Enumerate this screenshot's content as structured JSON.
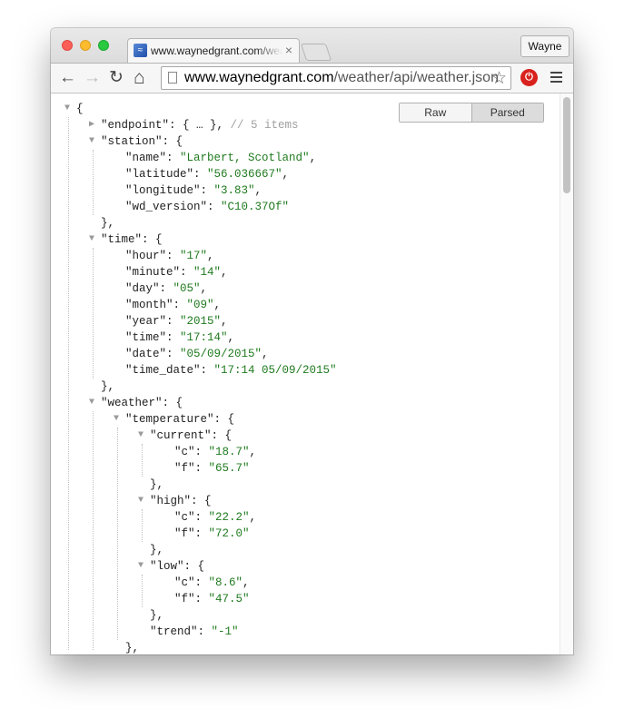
{
  "tab": {
    "title": "www.waynedgrant.com/weather/api/weather.json",
    "close": "×"
  },
  "profile": {
    "name": "Wayne"
  },
  "omnibox": {
    "host": "www.waynedgrant.com",
    "path": "/weather/api/weather.json"
  },
  "icons": {
    "back": "←",
    "forward": "→",
    "reload": "↻",
    "home": "⌂",
    "star": "☆",
    "ext": "⏻"
  },
  "view_toggle": {
    "raw": "Raw",
    "parsed": "Parsed"
  },
  "json_lines": [
    {
      "depth": 0,
      "arrow": "▼",
      "t": [
        [
          "p",
          "{"
        ]
      ]
    },
    {
      "depth": 1,
      "arrow": "▶",
      "t": [
        [
          "k",
          "\"endpoint\""
        ],
        [
          "p",
          ": { … }, "
        ],
        [
          "c",
          "// 5 items"
        ]
      ]
    },
    {
      "depth": 1,
      "arrow": "▼",
      "t": [
        [
          "k",
          "\"station\""
        ],
        [
          "p",
          ": {"
        ]
      ]
    },
    {
      "depth": 2,
      "t": [
        [
          "k",
          "\"name\""
        ],
        [
          "p",
          ": "
        ],
        [
          "s",
          "\"Larbert, Scotland\""
        ],
        [
          "p",
          ","
        ]
      ]
    },
    {
      "depth": 2,
      "t": [
        [
          "k",
          "\"latitude\""
        ],
        [
          "p",
          ": "
        ],
        [
          "s",
          "\"56.036667\""
        ],
        [
          "p",
          ","
        ]
      ]
    },
    {
      "depth": 2,
      "t": [
        [
          "k",
          "\"longitude\""
        ],
        [
          "p",
          ": "
        ],
        [
          "s",
          "\"3.83\""
        ],
        [
          "p",
          ","
        ]
      ]
    },
    {
      "depth": 2,
      "t": [
        [
          "k",
          "\"wd_version\""
        ],
        [
          "p",
          ": "
        ],
        [
          "s",
          "\"C10.37Of\""
        ]
      ]
    },
    {
      "depth": 1,
      "t": [
        [
          "p",
          "},"
        ]
      ]
    },
    {
      "depth": 1,
      "arrow": "▼",
      "t": [
        [
          "k",
          "\"time\""
        ],
        [
          "p",
          ": {"
        ]
      ]
    },
    {
      "depth": 2,
      "t": [
        [
          "k",
          "\"hour\""
        ],
        [
          "p",
          ": "
        ],
        [
          "s",
          "\"17\""
        ],
        [
          "p",
          ","
        ]
      ]
    },
    {
      "depth": 2,
      "t": [
        [
          "k",
          "\"minute\""
        ],
        [
          "p",
          ": "
        ],
        [
          "s",
          "\"14\""
        ],
        [
          "p",
          ","
        ]
      ]
    },
    {
      "depth": 2,
      "t": [
        [
          "k",
          "\"day\""
        ],
        [
          "p",
          ": "
        ],
        [
          "s",
          "\"05\""
        ],
        [
          "p",
          ","
        ]
      ]
    },
    {
      "depth": 2,
      "t": [
        [
          "k",
          "\"month\""
        ],
        [
          "p",
          ": "
        ],
        [
          "s",
          "\"09\""
        ],
        [
          "p",
          ","
        ]
      ]
    },
    {
      "depth": 2,
      "t": [
        [
          "k",
          "\"year\""
        ],
        [
          "p",
          ": "
        ],
        [
          "s",
          "\"2015\""
        ],
        [
          "p",
          ","
        ]
      ]
    },
    {
      "depth": 2,
      "t": [
        [
          "k",
          "\"time\""
        ],
        [
          "p",
          ": "
        ],
        [
          "s",
          "\"17:14\""
        ],
        [
          "p",
          ","
        ]
      ]
    },
    {
      "depth": 2,
      "t": [
        [
          "k",
          "\"date\""
        ],
        [
          "p",
          ": "
        ],
        [
          "s",
          "\"05/09/2015\""
        ],
        [
          "p",
          ","
        ]
      ]
    },
    {
      "depth": 2,
      "t": [
        [
          "k",
          "\"time_date\""
        ],
        [
          "p",
          ": "
        ],
        [
          "s",
          "\"17:14 05/09/2015\""
        ]
      ]
    },
    {
      "depth": 1,
      "t": [
        [
          "p",
          "},"
        ]
      ]
    },
    {
      "depth": 1,
      "arrow": "▼",
      "t": [
        [
          "k",
          "\"weather\""
        ],
        [
          "p",
          ": {"
        ]
      ]
    },
    {
      "depth": 2,
      "arrow": "▼",
      "t": [
        [
          "k",
          "\"temperature\""
        ],
        [
          "p",
          ": {"
        ]
      ]
    },
    {
      "depth": 3,
      "arrow": "▼",
      "t": [
        [
          "k",
          "\"current\""
        ],
        [
          "p",
          ": {"
        ]
      ]
    },
    {
      "depth": 4,
      "t": [
        [
          "k",
          "\"c\""
        ],
        [
          "p",
          ": "
        ],
        [
          "s",
          "\"18.7\""
        ],
        [
          "p",
          ","
        ]
      ]
    },
    {
      "depth": 4,
      "t": [
        [
          "k",
          "\"f\""
        ],
        [
          "p",
          ": "
        ],
        [
          "s",
          "\"65.7\""
        ]
      ]
    },
    {
      "depth": 3,
      "t": [
        [
          "p",
          "},"
        ]
      ]
    },
    {
      "depth": 3,
      "arrow": "▼",
      "t": [
        [
          "k",
          "\"high\""
        ],
        [
          "p",
          ": {"
        ]
      ]
    },
    {
      "depth": 4,
      "t": [
        [
          "k",
          "\"c\""
        ],
        [
          "p",
          ": "
        ],
        [
          "s",
          "\"22.2\""
        ],
        [
          "p",
          ","
        ]
      ]
    },
    {
      "depth": 4,
      "t": [
        [
          "k",
          "\"f\""
        ],
        [
          "p",
          ": "
        ],
        [
          "s",
          "\"72.0\""
        ]
      ]
    },
    {
      "depth": 3,
      "t": [
        [
          "p",
          "},"
        ]
      ]
    },
    {
      "depth": 3,
      "arrow": "▼",
      "t": [
        [
          "k",
          "\"low\""
        ],
        [
          "p",
          ": {"
        ]
      ]
    },
    {
      "depth": 4,
      "t": [
        [
          "k",
          "\"c\""
        ],
        [
          "p",
          ": "
        ],
        [
          "s",
          "\"8.6\""
        ],
        [
          "p",
          ","
        ]
      ]
    },
    {
      "depth": 4,
      "t": [
        [
          "k",
          "\"f\""
        ],
        [
          "p",
          ": "
        ],
        [
          "s",
          "\"47.5\""
        ]
      ]
    },
    {
      "depth": 3,
      "t": [
        [
          "p",
          "},"
        ]
      ]
    },
    {
      "depth": 3,
      "t": [
        [
          "k",
          "\"trend\""
        ],
        [
          "p",
          ": "
        ],
        [
          "s",
          "\"-1\""
        ]
      ]
    },
    {
      "depth": 2,
      "t": [
        [
          "p",
          "},"
        ]
      ]
    }
  ]
}
